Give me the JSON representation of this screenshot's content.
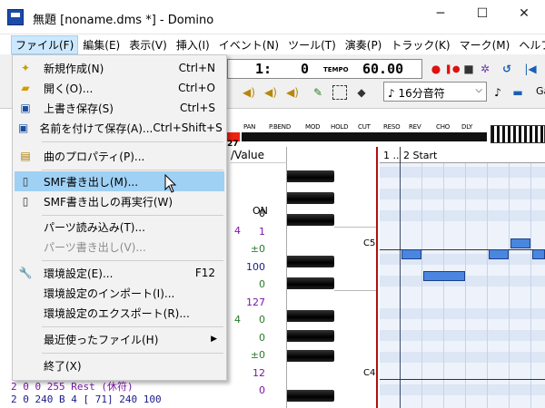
{
  "window": {
    "title": "無題 [noname.dms *] - Domino",
    "minimize": "─",
    "maximize": "☐",
    "close": "✕"
  },
  "menubar": [
    {
      "label": "ファイル(F)"
    },
    {
      "label": "編集(E)"
    },
    {
      "label": "表示(V)"
    },
    {
      "label": "挿入(I)"
    },
    {
      "label": "イベント(N)"
    },
    {
      "label": "ツール(T)"
    },
    {
      "label": "演奏(P)"
    },
    {
      "label": "トラック(K)"
    },
    {
      "label": "マーク(M)"
    },
    {
      "label": "ヘルプ(H)"
    }
  ],
  "toolbar": {
    "position_value1": "1:",
    "position_value2": "0",
    "tempo_label": "TEMPO",
    "tempo_value": "60.00",
    "note_length": "♪ 16分音符",
    "ga_label": "Ga"
  },
  "controllers": [
    "PAN",
    "P.BEND",
    "MOD",
    "HOLD",
    "CUT",
    "RESO",
    "REV",
    "CHO",
    "DLY"
  ],
  "controller_value_first": "27",
  "file_menu": [
    {
      "label": "新規作成(N)",
      "shortcut": "Ctrl+N",
      "icon": "new-file-icon"
    },
    {
      "label": "開く(O)...",
      "shortcut": "Ctrl+O",
      "icon": "open-folder-icon"
    },
    {
      "label": "上書き保存(S)",
      "shortcut": "Ctrl+S",
      "icon": "save-icon"
    },
    {
      "label": "名前を付けて保存(A)...",
      "shortcut": "Ctrl+Shift+S",
      "icon": "save-as-icon"
    },
    {
      "label": "曲のプロパティ(P)...",
      "shortcut": "",
      "icon": "properties-icon"
    },
    {
      "label": "SMF書き出し(M)...",
      "shortcut": "",
      "icon": "smf-export-icon",
      "highlighted": true
    },
    {
      "label": "SMF書き出しの再実行(W)",
      "shortcut": "",
      "icon": "smf-reexport-icon"
    },
    {
      "label": "パーツ読み込み(T)...",
      "shortcut": "",
      "icon": ""
    },
    {
      "label": "パーツ書き出し(V)...",
      "shortcut": "",
      "icon": "",
      "disabled": true
    },
    {
      "label": "環境設定(E)...",
      "shortcut": "F12",
      "icon": "wrench-icon"
    },
    {
      "label": "環境設定のインポート(I)...",
      "shortcut": "",
      "icon": ""
    },
    {
      "label": "環境設定のエクスポート(R)...",
      "shortcut": "",
      "icon": ""
    },
    {
      "label": "最近使ったファイル(H)",
      "shortcut": "",
      "icon": "",
      "submenu": true
    },
    {
      "label": "終了(X)",
      "shortcut": "",
      "icon": ""
    }
  ],
  "event_list": {
    "value_header": "/Value",
    "values": [
      {
        "text": "0",
        "color": "#000000"
      },
      {
        "text": "1",
        "color": "#7b16a6"
      },
      {
        "text": "±0",
        "color": "#2a7a2a"
      },
      {
        "text": "100",
        "color": "#1b1b8a"
      },
      {
        "text": "0",
        "color": "#2a7a2a"
      },
      {
        "text": "127",
        "color": "#7b16a6"
      },
      {
        "text": "0",
        "color": "#2a7a2a"
      },
      {
        "text": "0",
        "color": "#2a7a2a"
      },
      {
        "text": "±0",
        "color": "#2a7a2a"
      },
      {
        "text": "12",
        "color": "#7b16a6"
      },
      {
        "text": "0",
        "color": "#7b16a6"
      }
    ],
    "on_label": "ON",
    "partial_4a": "4",
    "partial_4b": "4",
    "rest_row": "2     0   0  255 Rest (休符)",
    "note_row": "2     0 240  B  4 [ 71]        240    100"
  },
  "piano_roll": {
    "header_1": "1 ..",
    "header_2": "2 Start",
    "key_c5": "C5",
    "key_c4": "C4"
  }
}
